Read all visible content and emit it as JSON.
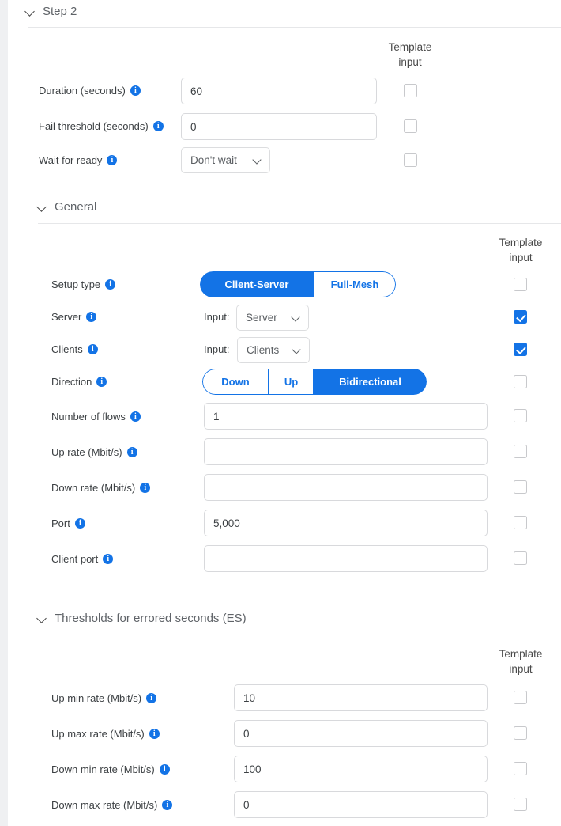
{
  "sections": [
    {
      "id": "step2",
      "title": "Step 2",
      "level": 1,
      "template_header": {
        "line1": "Template",
        "line2": "input"
      },
      "rows": [
        {
          "label": "Duration (seconds)",
          "type": "text",
          "value": "60",
          "template_input": false
        },
        {
          "label": "Fail threshold (seconds)",
          "type": "text",
          "value": "0",
          "template_input": false
        },
        {
          "label": "Wait for ready",
          "type": "select",
          "value": "Don't wait",
          "template_input": false
        }
      ]
    },
    {
      "id": "general",
      "title": "General",
      "level": 2,
      "template_header": {
        "line1": "Template",
        "line2": "input"
      },
      "rows": [
        {
          "label": "Setup type",
          "type": "toggle",
          "options": [
            "Client-Server",
            "Full-Mesh"
          ],
          "selected": "Client-Server",
          "template_input": false
        },
        {
          "label": "Server",
          "type": "input-select",
          "prefix": "Input:",
          "value": "Server",
          "template_input": true
        },
        {
          "label": "Clients",
          "type": "input-select",
          "prefix": "Input:",
          "value": "Clients",
          "template_input": true
        },
        {
          "label": "Direction",
          "type": "toggle",
          "options": [
            "Down",
            "Up",
            "Bidirectional"
          ],
          "selected": "Bidirectional",
          "template_input": false
        },
        {
          "label": "Number of flows",
          "type": "text",
          "value": "1",
          "template_input": false
        },
        {
          "label": "Up rate (Mbit/s)",
          "type": "text",
          "value": "",
          "template_input": false
        },
        {
          "label": "Down rate (Mbit/s)",
          "type": "text",
          "value": "",
          "template_input": false
        },
        {
          "label": "Port",
          "type": "text",
          "value": "5,000",
          "template_input": false
        },
        {
          "label": "Client port",
          "type": "text",
          "value": "",
          "template_input": false
        }
      ]
    },
    {
      "id": "thresholds",
      "title": "Thresholds for errored seconds (ES)",
      "level": 2,
      "template_header": {
        "line1": "Template",
        "line2": "input"
      },
      "rows": [
        {
          "label": "Up min rate (Mbit/s)",
          "type": "text",
          "value": "10",
          "template_input": false
        },
        {
          "label": "Up max rate (Mbit/s)",
          "type": "text",
          "value": "0",
          "template_input": false
        },
        {
          "label": "Down min rate (Mbit/s)",
          "type": "text",
          "value": "100",
          "template_input": false
        },
        {
          "label": "Down max rate (Mbit/s)",
          "type": "text",
          "value": "0",
          "template_input": false
        }
      ]
    }
  ],
  "colors": {
    "accent": "#1373e6",
    "label": "#3c4043",
    "muted": "#5f6368",
    "border": "#d8d9dc",
    "page_bg": "#eff0f2"
  },
  "icons": {
    "info": "info-icon",
    "chevron_down": "chevron-down-icon",
    "checkmark": "check-icon"
  }
}
